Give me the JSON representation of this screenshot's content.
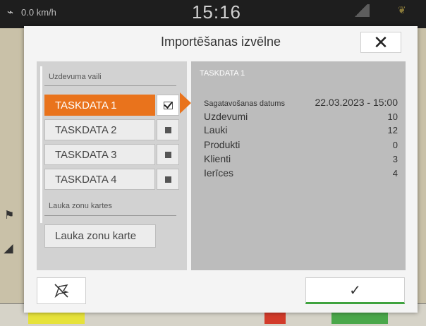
{
  "status_bar": {
    "speed": "0.0 km/h",
    "clock": "15:16"
  },
  "dialog": {
    "title": "Importēšanas izvēlne",
    "close_glyph": "✕"
  },
  "left_panel": {
    "task_files_label": "Uzdevuma vaili",
    "files": [
      {
        "label": "TASKDATA 1",
        "selected": true
      },
      {
        "label": "TASKDATA 2",
        "selected": false
      },
      {
        "label": "TASKDATA 3",
        "selected": false
      },
      {
        "label": "TASKDATA 4",
        "selected": false
      }
    ],
    "zone_maps_label": "Lauka zonu kartes",
    "zone_map_button": "Lauka zonu karte"
  },
  "right_panel": {
    "title": "TASKDATA 1",
    "details": [
      {
        "label": "Sagatavošanas datums",
        "value": "22.03.2023 - 15:00"
      },
      {
        "label": "Uzdevumi",
        "value": "10"
      },
      {
        "label": "Lauki",
        "value": "12"
      },
      {
        "label": "Produkti",
        "value": "0"
      },
      {
        "label": "Klienti",
        "value": "3"
      },
      {
        "label": "Ierīces",
        "value": "4"
      }
    ]
  },
  "footer": {
    "confirm_glyph": "✓"
  },
  "colors": {
    "accent_orange": "#e9731c",
    "confirm_green": "#3fa33f"
  }
}
